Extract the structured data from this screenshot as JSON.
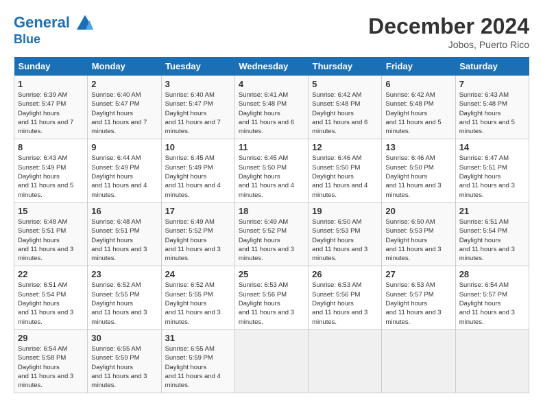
{
  "header": {
    "logo_line1": "General",
    "logo_line2": "Blue",
    "month_year": "December 2024",
    "location": "Jobos, Puerto Rico"
  },
  "days_of_week": [
    "Sunday",
    "Monday",
    "Tuesday",
    "Wednesday",
    "Thursday",
    "Friday",
    "Saturday"
  ],
  "weeks": [
    [
      {
        "day": 1,
        "sunrise": "6:39 AM",
        "sunset": "5:47 PM",
        "daylight": "11 hours and 7 minutes."
      },
      {
        "day": 2,
        "sunrise": "6:40 AM",
        "sunset": "5:47 PM",
        "daylight": "11 hours and 7 minutes."
      },
      {
        "day": 3,
        "sunrise": "6:40 AM",
        "sunset": "5:47 PM",
        "daylight": "11 hours and 7 minutes."
      },
      {
        "day": 4,
        "sunrise": "6:41 AM",
        "sunset": "5:48 PM",
        "daylight": "11 hours and 6 minutes."
      },
      {
        "day": 5,
        "sunrise": "6:42 AM",
        "sunset": "5:48 PM",
        "daylight": "11 hours and 6 minutes."
      },
      {
        "day": 6,
        "sunrise": "6:42 AM",
        "sunset": "5:48 PM",
        "daylight": "11 hours and 5 minutes."
      },
      {
        "day": 7,
        "sunrise": "6:43 AM",
        "sunset": "5:48 PM",
        "daylight": "11 hours and 5 minutes."
      }
    ],
    [
      {
        "day": 8,
        "sunrise": "6:43 AM",
        "sunset": "5:49 PM",
        "daylight": "11 hours and 5 minutes."
      },
      {
        "day": 9,
        "sunrise": "6:44 AM",
        "sunset": "5:49 PM",
        "daylight": "11 hours and 4 minutes."
      },
      {
        "day": 10,
        "sunrise": "6:45 AM",
        "sunset": "5:49 PM",
        "daylight": "11 hours and 4 minutes."
      },
      {
        "day": 11,
        "sunrise": "6:45 AM",
        "sunset": "5:50 PM",
        "daylight": "11 hours and 4 minutes."
      },
      {
        "day": 12,
        "sunrise": "6:46 AM",
        "sunset": "5:50 PM",
        "daylight": "11 hours and 4 minutes."
      },
      {
        "day": 13,
        "sunrise": "6:46 AM",
        "sunset": "5:50 PM",
        "daylight": "11 hours and 3 minutes."
      },
      {
        "day": 14,
        "sunrise": "6:47 AM",
        "sunset": "5:51 PM",
        "daylight": "11 hours and 3 minutes."
      }
    ],
    [
      {
        "day": 15,
        "sunrise": "6:48 AM",
        "sunset": "5:51 PM",
        "daylight": "11 hours and 3 minutes."
      },
      {
        "day": 16,
        "sunrise": "6:48 AM",
        "sunset": "5:51 PM",
        "daylight": "11 hours and 3 minutes."
      },
      {
        "day": 17,
        "sunrise": "6:49 AM",
        "sunset": "5:52 PM",
        "daylight": "11 hours and 3 minutes."
      },
      {
        "day": 18,
        "sunrise": "6:49 AM",
        "sunset": "5:52 PM",
        "daylight": "11 hours and 3 minutes."
      },
      {
        "day": 19,
        "sunrise": "6:50 AM",
        "sunset": "5:53 PM",
        "daylight": "11 hours and 3 minutes."
      },
      {
        "day": 20,
        "sunrise": "6:50 AM",
        "sunset": "5:53 PM",
        "daylight": "11 hours and 3 minutes."
      },
      {
        "day": 21,
        "sunrise": "6:51 AM",
        "sunset": "5:54 PM",
        "daylight": "11 hours and 3 minutes."
      }
    ],
    [
      {
        "day": 22,
        "sunrise": "6:51 AM",
        "sunset": "5:54 PM",
        "daylight": "11 hours and 3 minutes."
      },
      {
        "day": 23,
        "sunrise": "6:52 AM",
        "sunset": "5:55 PM",
        "daylight": "11 hours and 3 minutes."
      },
      {
        "day": 24,
        "sunrise": "6:52 AM",
        "sunset": "5:55 PM",
        "daylight": "11 hours and 3 minutes."
      },
      {
        "day": 25,
        "sunrise": "6:53 AM",
        "sunset": "5:56 PM",
        "daylight": "11 hours and 3 minutes."
      },
      {
        "day": 26,
        "sunrise": "6:53 AM",
        "sunset": "5:56 PM",
        "daylight": "11 hours and 3 minutes."
      },
      {
        "day": 27,
        "sunrise": "6:53 AM",
        "sunset": "5:57 PM",
        "daylight": "11 hours and 3 minutes."
      },
      {
        "day": 28,
        "sunrise": "6:54 AM",
        "sunset": "5:57 PM",
        "daylight": "11 hours and 3 minutes."
      }
    ],
    [
      {
        "day": 29,
        "sunrise": "6:54 AM",
        "sunset": "5:58 PM",
        "daylight": "11 hours and 3 minutes."
      },
      {
        "day": 30,
        "sunrise": "6:55 AM",
        "sunset": "5:59 PM",
        "daylight": "11 hours and 3 minutes."
      },
      {
        "day": 31,
        "sunrise": "6:55 AM",
        "sunset": "5:59 PM",
        "daylight": "11 hours and 4 minutes."
      },
      null,
      null,
      null,
      null
    ]
  ]
}
